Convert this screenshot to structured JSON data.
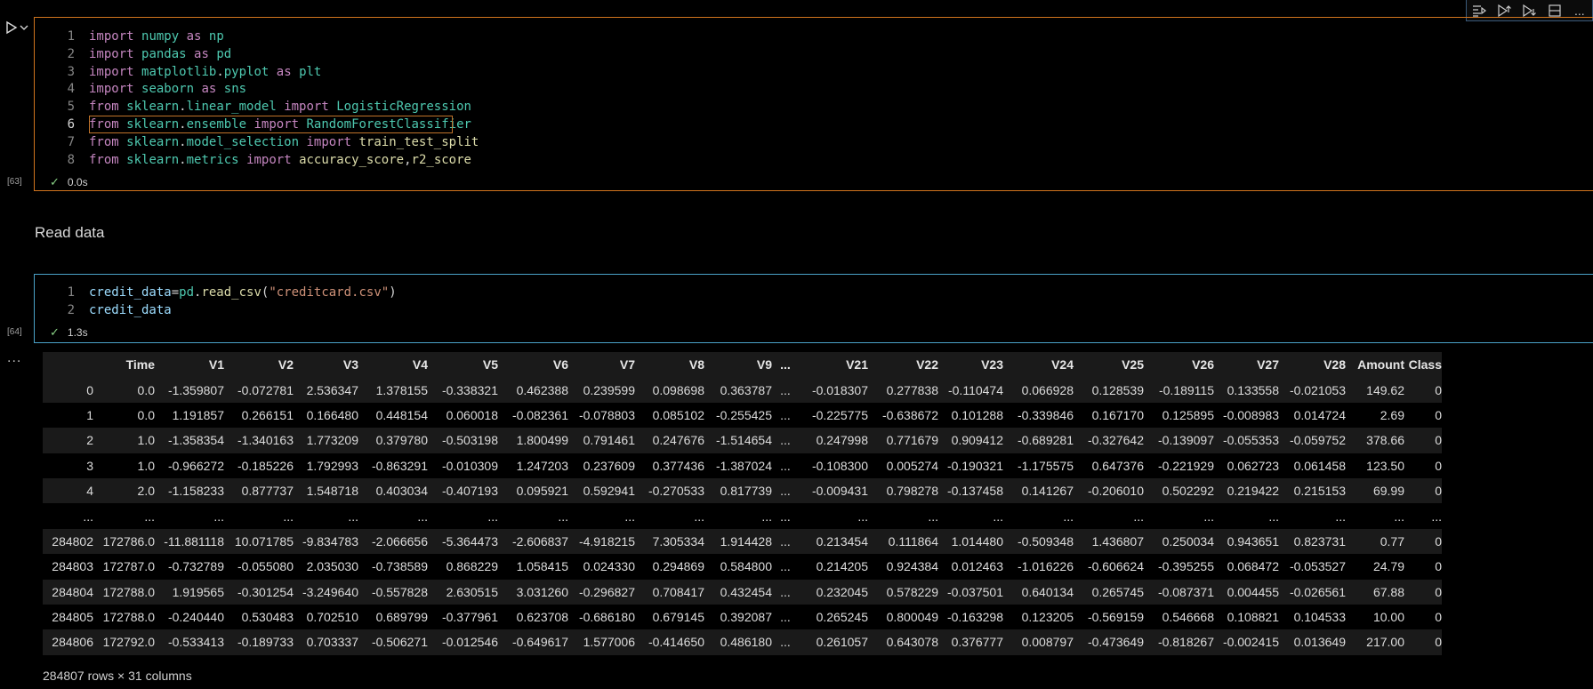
{
  "toolbar": {
    "icons": [
      "run-by-line-icon",
      "execute-above-icon",
      "execute-below-icon",
      "split-cell-icon",
      "more-icon"
    ],
    "more_label": "..."
  },
  "cell1": {
    "lines": [
      {
        "n": "1",
        "parts": [
          [
            "kw",
            "import"
          ],
          [
            "pl",
            " "
          ],
          [
            "mod",
            "numpy"
          ],
          [
            "pl",
            " "
          ],
          [
            "kw",
            "as"
          ],
          [
            "pl",
            " "
          ],
          [
            "mod",
            "np"
          ]
        ]
      },
      {
        "n": "2",
        "parts": [
          [
            "kw",
            "import"
          ],
          [
            "pl",
            " "
          ],
          [
            "mod",
            "pandas"
          ],
          [
            "pl",
            " "
          ],
          [
            "kw",
            "as"
          ],
          [
            "pl",
            " "
          ],
          [
            "mod",
            "pd"
          ]
        ]
      },
      {
        "n": "3",
        "parts": [
          [
            "kw",
            "import"
          ],
          [
            "pl",
            " "
          ],
          [
            "mod",
            "matplotlib"
          ],
          [
            "pl",
            "."
          ],
          [
            "mod",
            "pyplot"
          ],
          [
            "pl",
            " "
          ],
          [
            "kw",
            "as"
          ],
          [
            "pl",
            " "
          ],
          [
            "mod",
            "plt"
          ]
        ]
      },
      {
        "n": "4",
        "parts": [
          [
            "kw",
            "import"
          ],
          [
            "pl",
            " "
          ],
          [
            "mod",
            "seaborn"
          ],
          [
            "pl",
            " "
          ],
          [
            "kw",
            "as"
          ],
          [
            "pl",
            " "
          ],
          [
            "mod",
            "sns"
          ]
        ]
      },
      {
        "n": "5",
        "parts": [
          [
            "kw",
            "from"
          ],
          [
            "pl",
            " "
          ],
          [
            "mod",
            "sklearn"
          ],
          [
            "pl",
            "."
          ],
          [
            "mod",
            "linear_model"
          ],
          [
            "pl",
            " "
          ],
          [
            "kw",
            "import"
          ],
          [
            "pl",
            " "
          ],
          [
            "mod",
            "LogisticRegression"
          ]
        ]
      },
      {
        "n": "6",
        "parts": [
          [
            "kw",
            "from"
          ],
          [
            "pl",
            " "
          ],
          [
            "mod",
            "sklearn"
          ],
          [
            "pl",
            "."
          ],
          [
            "mod",
            "ensemble"
          ],
          [
            "pl",
            " "
          ],
          [
            "kw",
            "import"
          ],
          [
            "pl",
            " "
          ],
          [
            "mod",
            "RandomForestClassifier"
          ]
        ]
      },
      {
        "n": "7",
        "parts": [
          [
            "kw",
            "from"
          ],
          [
            "pl",
            " "
          ],
          [
            "mod",
            "sklearn"
          ],
          [
            "pl",
            "."
          ],
          [
            "mod",
            "model_selection"
          ],
          [
            "pl",
            " "
          ],
          [
            "kw",
            "import"
          ],
          [
            "pl",
            " "
          ],
          [
            "fn",
            "train_test_split"
          ]
        ]
      },
      {
        "n": "8",
        "parts": [
          [
            "kw",
            "from"
          ],
          [
            "pl",
            " "
          ],
          [
            "mod",
            "sklearn"
          ],
          [
            "pl",
            "."
          ],
          [
            "mod",
            "metrics"
          ],
          [
            "pl",
            " "
          ],
          [
            "kw",
            "import"
          ],
          [
            "pl",
            " "
          ],
          [
            "fn",
            "accuracy_score"
          ],
          [
            "pl",
            ","
          ],
          [
            "fn",
            "r2_score"
          ]
        ]
      }
    ],
    "exec_count": "[63]",
    "duration": "0.0s"
  },
  "markdown": {
    "heading": "Read data"
  },
  "cell2": {
    "lines": [
      {
        "n": "1",
        "parts": [
          [
            "id",
            "credit_data"
          ],
          [
            "pl",
            "="
          ],
          [
            "mod",
            "pd"
          ],
          [
            "pl",
            "."
          ],
          [
            "fn",
            "read_csv"
          ],
          [
            "pl",
            "("
          ],
          [
            "str",
            "\"creditcard.csv\""
          ],
          [
            "pl",
            ")"
          ]
        ]
      },
      {
        "n": "2",
        "parts": [
          [
            "id",
            "credit_data"
          ]
        ]
      }
    ],
    "exec_count": "[64]",
    "duration": "1.3s"
  },
  "output": {
    "ellipsis": "...",
    "columns": [
      "",
      "Time",
      "V1",
      "V2",
      "V3",
      "V4",
      "V5",
      "V6",
      "V7",
      "V8",
      "V9",
      "...",
      "V21",
      "V22",
      "V23",
      "V24",
      "V25",
      "V26",
      "V27",
      "V28",
      "Amount",
      "Class"
    ],
    "rows": [
      [
        "0",
        "0.0",
        "-1.359807",
        "-0.072781",
        "2.536347",
        "1.378155",
        "-0.338321",
        "0.462388",
        "0.239599",
        "0.098698",
        "0.363787",
        "...",
        "-0.018307",
        "0.277838",
        "-0.110474",
        "0.066928",
        "0.128539",
        "-0.189115",
        "0.133558",
        "-0.021053",
        "149.62",
        "0"
      ],
      [
        "1",
        "0.0",
        "1.191857",
        "0.266151",
        "0.166480",
        "0.448154",
        "0.060018",
        "-0.082361",
        "-0.078803",
        "0.085102",
        "-0.255425",
        "...",
        "-0.225775",
        "-0.638672",
        "0.101288",
        "-0.339846",
        "0.167170",
        "0.125895",
        "-0.008983",
        "0.014724",
        "2.69",
        "0"
      ],
      [
        "2",
        "1.0",
        "-1.358354",
        "-1.340163",
        "1.773209",
        "0.379780",
        "-0.503198",
        "1.800499",
        "0.791461",
        "0.247676",
        "-1.514654",
        "...",
        "0.247998",
        "0.771679",
        "0.909412",
        "-0.689281",
        "-0.327642",
        "-0.139097",
        "-0.055353",
        "-0.059752",
        "378.66",
        "0"
      ],
      [
        "3",
        "1.0",
        "-0.966272",
        "-0.185226",
        "1.792993",
        "-0.863291",
        "-0.010309",
        "1.247203",
        "0.237609",
        "0.377436",
        "-1.387024",
        "...",
        "-0.108300",
        "0.005274",
        "-0.190321",
        "-1.175575",
        "0.647376",
        "-0.221929",
        "0.062723",
        "0.061458",
        "123.50",
        "0"
      ],
      [
        "4",
        "2.0",
        "-1.158233",
        "0.877737",
        "1.548718",
        "0.403034",
        "-0.407193",
        "0.095921",
        "0.592941",
        "-0.270533",
        "0.817739",
        "...",
        "-0.009431",
        "0.798278",
        "-0.137458",
        "0.141267",
        "-0.206010",
        "0.502292",
        "0.219422",
        "0.215153",
        "69.99",
        "0"
      ],
      [
        "...",
        "...",
        "...",
        "...",
        "...",
        "...",
        "...",
        "...",
        "...",
        "...",
        "...",
        "...",
        "...",
        "...",
        "...",
        "...",
        "...",
        "...",
        "...",
        "...",
        "...",
        "..."
      ],
      [
        "284802",
        "172786.0",
        "-11.881118",
        "10.071785",
        "-9.834783",
        "-2.066656",
        "-5.364473",
        "-2.606837",
        "-4.918215",
        "7.305334",
        "1.914428",
        "...",
        "0.213454",
        "0.111864",
        "1.014480",
        "-0.509348",
        "1.436807",
        "0.250034",
        "0.943651",
        "0.823731",
        "0.77",
        "0"
      ],
      [
        "284803",
        "172787.0",
        "-0.732789",
        "-0.055080",
        "2.035030",
        "-0.738589",
        "0.868229",
        "1.058415",
        "0.024330",
        "0.294869",
        "0.584800",
        "...",
        "0.214205",
        "0.924384",
        "0.012463",
        "-1.016226",
        "-0.606624",
        "-0.395255",
        "0.068472",
        "-0.053527",
        "24.79",
        "0"
      ],
      [
        "284804",
        "172788.0",
        "1.919565",
        "-0.301254",
        "-3.249640",
        "-0.557828",
        "2.630515",
        "3.031260",
        "-0.296827",
        "0.708417",
        "0.432454",
        "...",
        "0.232045",
        "0.578229",
        "-0.037501",
        "0.640134",
        "0.265745",
        "-0.087371",
        "0.004455",
        "-0.026561",
        "67.88",
        "0"
      ],
      [
        "284805",
        "172788.0",
        "-0.240440",
        "0.530483",
        "0.702510",
        "0.689799",
        "-0.377961",
        "0.623708",
        "-0.686180",
        "0.679145",
        "0.392087",
        "...",
        "0.265245",
        "0.800049",
        "-0.163298",
        "0.123205",
        "-0.569159",
        "0.546668",
        "0.108821",
        "0.104533",
        "10.00",
        "0"
      ],
      [
        "284806",
        "172792.0",
        "-0.533413",
        "-0.189733",
        "0.703337",
        "-0.506271",
        "-0.012546",
        "-0.649617",
        "1.577006",
        "-0.414650",
        "0.486180",
        "...",
        "0.261057",
        "0.643078",
        "0.376777",
        "0.008797",
        "-0.473649",
        "-0.818267",
        "-0.002415",
        "0.013649",
        "217.00",
        "0"
      ]
    ],
    "shape": "284807 rows × 31 columns"
  }
}
